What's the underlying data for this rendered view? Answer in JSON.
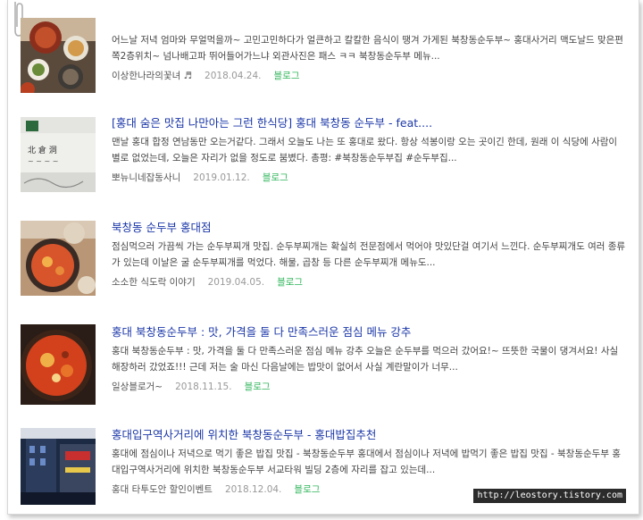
{
  "results": [
    {
      "title": "",
      "desc": "어느날 저녁 엄마와 무얼먹을까~ 고민고민하다가 얼큰하고 칼칼한 음식이 땡겨 가게된 북창동순두부~ 홍대사거리 맥도날드 맞은편쪽2층위치~ 넘나배고파 뛰어들어가느냐 외관사진은 패스 ㅋㅋ 북창동순두부 메뉴...",
      "author": "이상한나라의꽃녀 ♬",
      "date": "2018.04.24.",
      "category": "블로그",
      "thumb": "kimchi-stew-table"
    },
    {
      "title": "[홍대 숨은 맛집 나만아는 그런 한식당] 홍대 북창동 순두부 - feat....",
      "desc": "맨날 홍대 합정 연남동만 오는거같다. 그래서 오늘도 나는 또 홍대로 왔다. 항상 석봉이랑 오는 곳이긴 한데, 원래 이 식당에 사람이 별로 없었는데, 오늘은 자리가 없을 정도로 붐볐다. 총평: #북창동순두부집 #순두부집...",
      "author": "뽀뉴니네잡동사니",
      "date": "2019.01.12.",
      "category": "블로그",
      "thumb": "restaurant-sign"
    },
    {
      "title": "북창동 순두부 홍대점",
      "desc": "점심먹으러 가끔씩 가는 순두부찌개 맛집. 순두부찌개는 확실히 전문점에서 먹어야 맛있단걸 여기서 느낀다. 순두부찌개도 여러 종류가 있는데 이날은 굴 순두부찌개를 먹었다. 해물, 곱창 등 다른 순두부찌개 메뉴도...",
      "author": "소소한 식도락 이야기",
      "date": "2019.04.05.",
      "category": "블로그",
      "thumb": "tofu-stew-pot"
    },
    {
      "title": "홍대 북창동순두부 : 맛, 가격을 둘 다 만족스러운 점심 메뉴 강추",
      "desc": "홍대 북창동순두부 : 맛, 가격을 둘 다 만족스러운 점심 메뉴 강추 오늘은 순두부를 먹으러 갔어요!~ 뜨뜻한 국물이 댕겨서요! 사실 해장하러 갔었죠!!! 근데 저는 술 마신 다음날에는 밥맛이 없어서 사실 계란말이가 너무...",
      "author": "일상블로거~",
      "date": "2018.11.15.",
      "category": "블로그",
      "thumb": "red-stew-egg"
    },
    {
      "title": "홍대입구역사거리에 위치한 북창동순두부 - 홍대밥집추천",
      "desc": "홍대에 점심이나 저녁으로 먹기 좋은 밥집 맛집 - 북창동순두부 홍대에서 점심이나 저녁에 밥먹기 좋은 밥집 맛집 - 북창동순두부 홍대입구역사거리에 위치한 북창동순두부 서교타워 빌딩 2층에 자리를 잡고 있는데...",
      "author": "홍대 타투도안 할인이벤트",
      "date": "2018.12.04.",
      "category": "블로그",
      "thumb": "building-exterior"
    }
  ],
  "watermark": "http://leostory.tistory.com",
  "colors": {
    "title": "#1b37a8",
    "category": "#2fb55a",
    "date": "#999999"
  }
}
